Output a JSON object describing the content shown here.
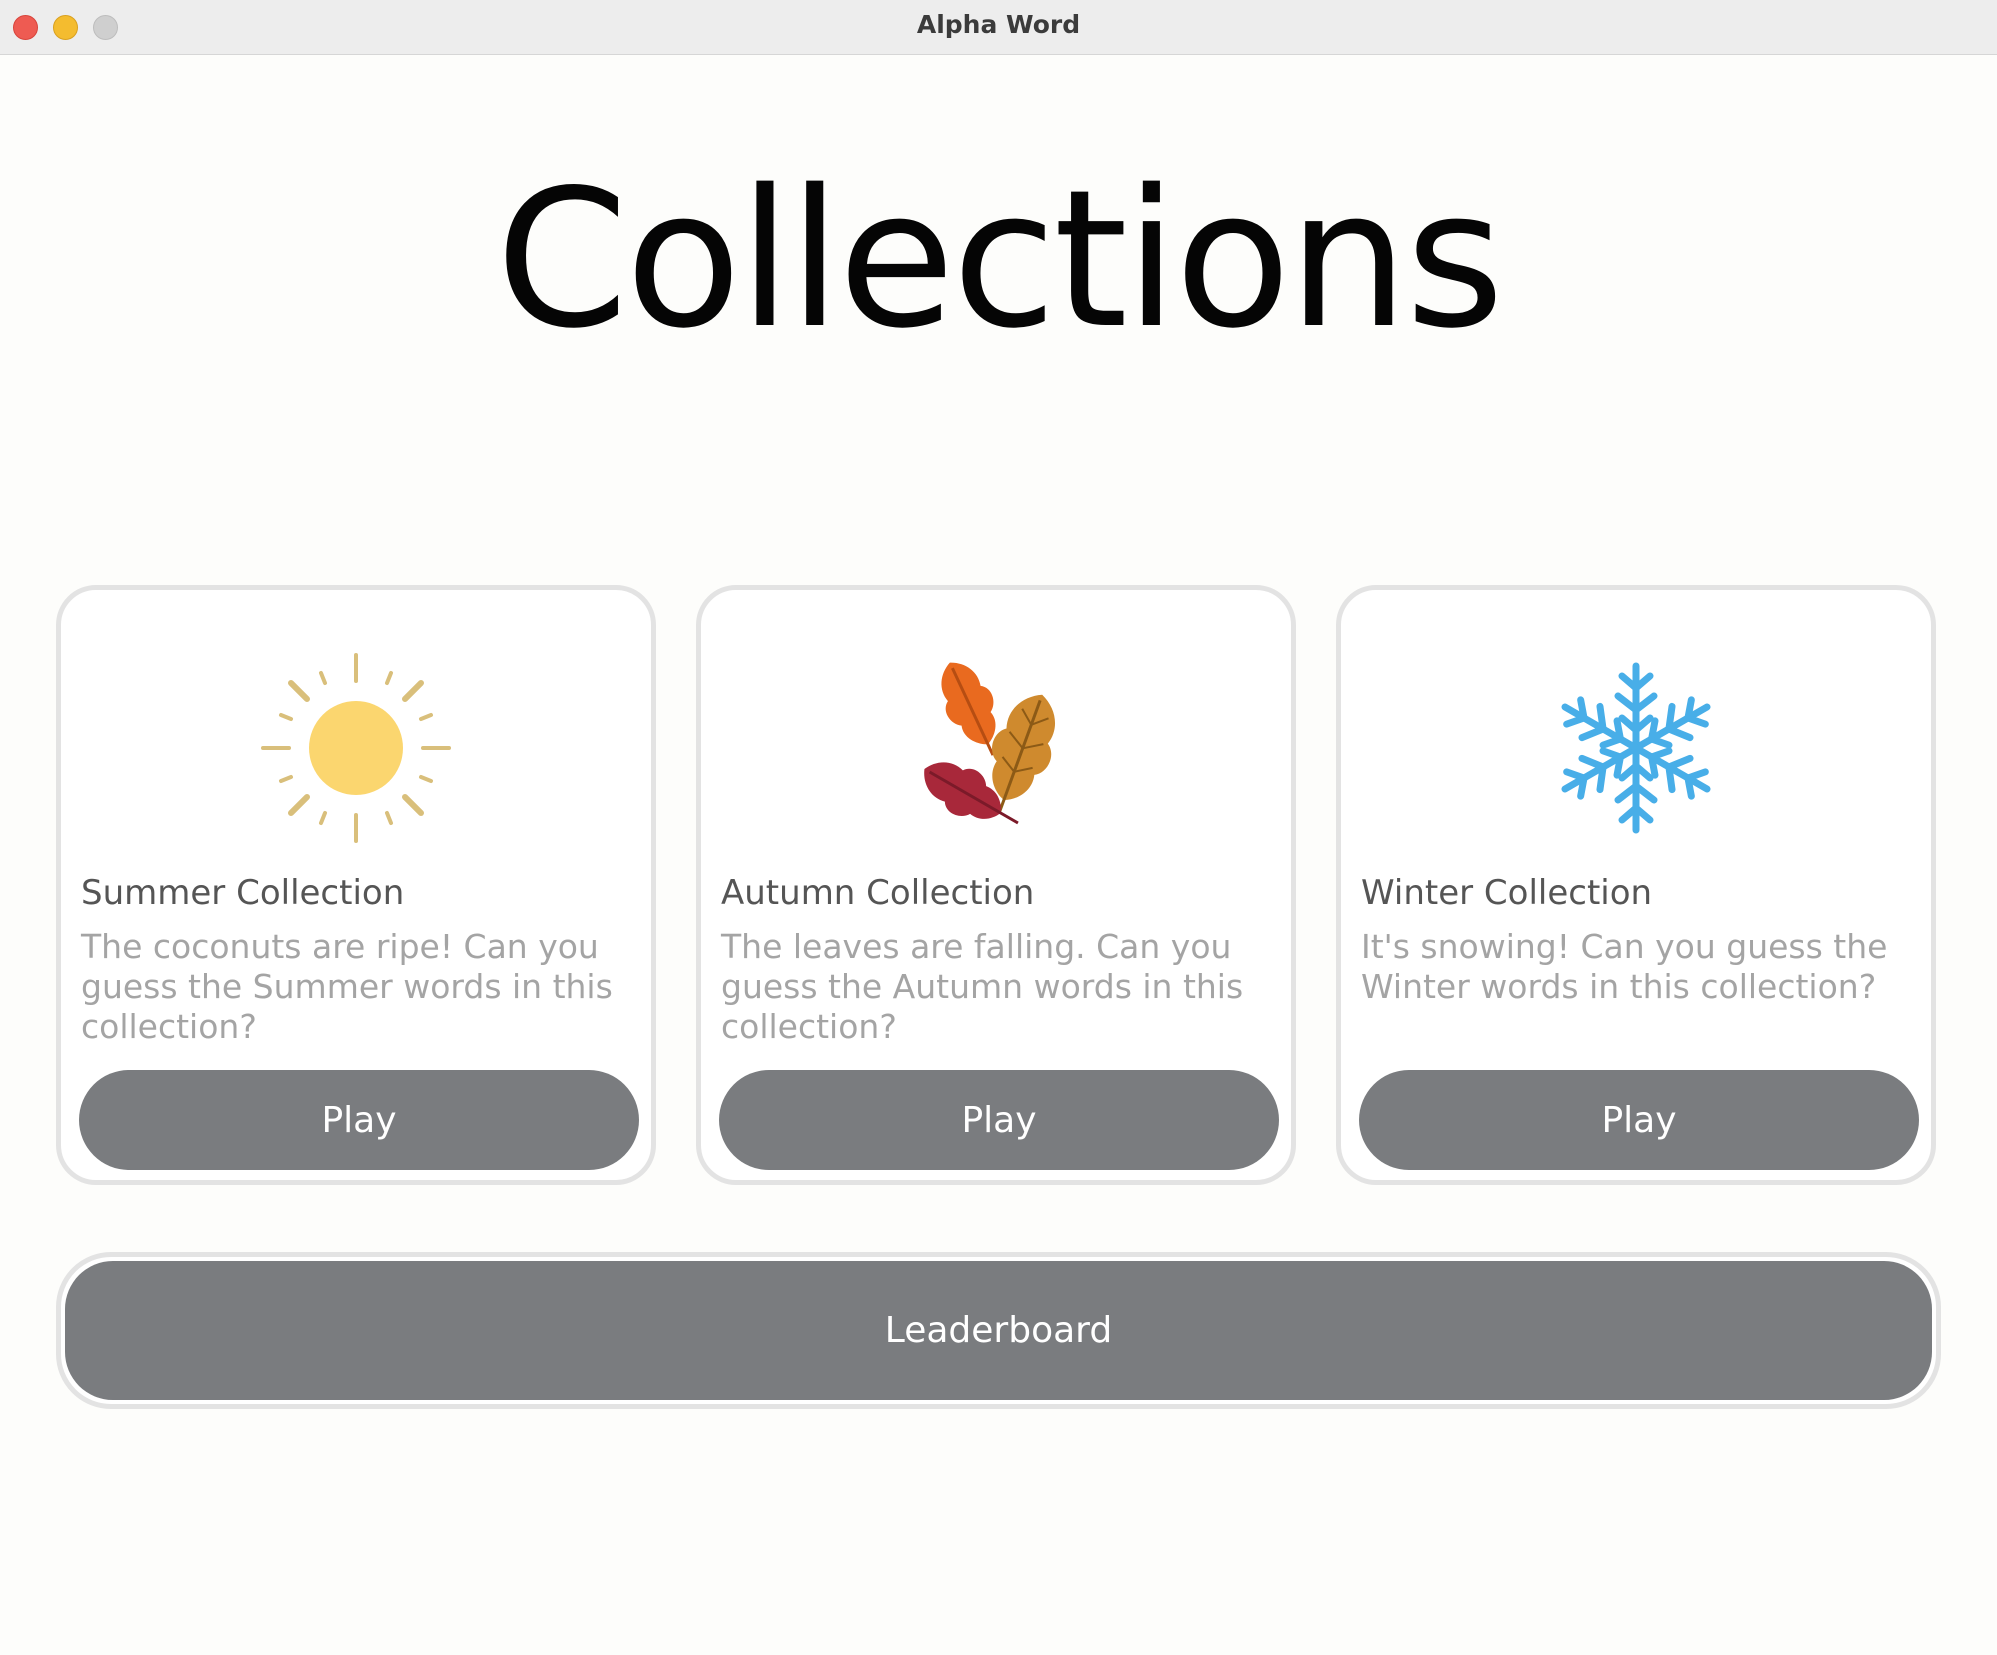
{
  "window": {
    "title": "Alpha Word"
  },
  "page": {
    "title": "Collections"
  },
  "collections": [
    {
      "title": "Summer Collection",
      "description": "The coconuts are ripe! Can you guess the Summer words in this collection?",
      "button_label": "Play",
      "icon": "sun-icon",
      "icon_color": "#fbd66f"
    },
    {
      "title": "Autumn Collection",
      "description": "The leaves are falling. Can you guess the Autumn words in this collection?",
      "button_label": "Play",
      "icon": "autumn-leaves-icon",
      "icon_color": "#d2892b"
    },
    {
      "title": "Winter Collection",
      "description": "It's snowing! Can you guess the Winter words in this collection?",
      "button_label": "Play",
      "icon": "snowflake-icon",
      "icon_color": "#48aee8"
    }
  ],
  "leaderboard": {
    "label": "Leaderboard"
  },
  "colors": {
    "button_bg": "#7a7c7f",
    "card_border": "#e3e3e3",
    "background": "#fdfdfb"
  }
}
